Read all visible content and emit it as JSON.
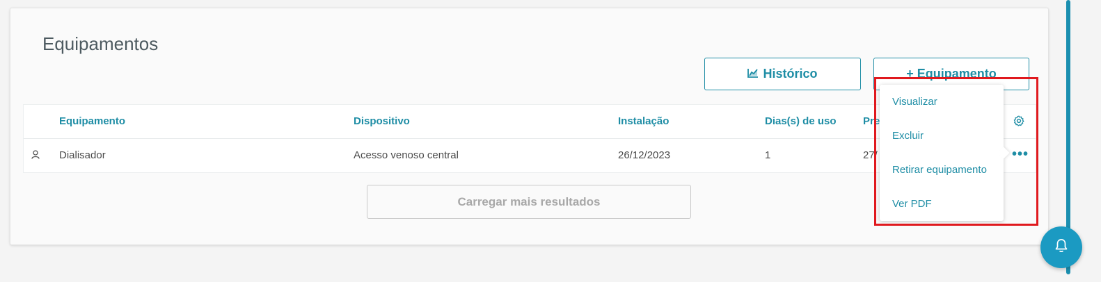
{
  "page": {
    "title": "Equipamentos",
    "history_button": "Histórico",
    "add_button": "+ Equipamento",
    "load_more": "Carregar mais resultados"
  },
  "table": {
    "headers": [
      "Equipamento",
      "Dispositivo",
      "Instalação",
      "Dias(s) de uso",
      "Pre"
    ],
    "rows": [
      {
        "equipamento": "Dialisador",
        "dispositivo": "Acesso venoso central",
        "instalacao": "26/12/2023",
        "dias": "1",
        "previsao": "27/"
      }
    ]
  },
  "dropdown": {
    "items": [
      "Visualizar",
      "Excluir",
      "Retirar equipamento",
      "Ver PDF"
    ]
  },
  "colors": {
    "accent": "#1e8da5",
    "highlight": "#e0191e",
    "fab": "#1b9ac2"
  }
}
